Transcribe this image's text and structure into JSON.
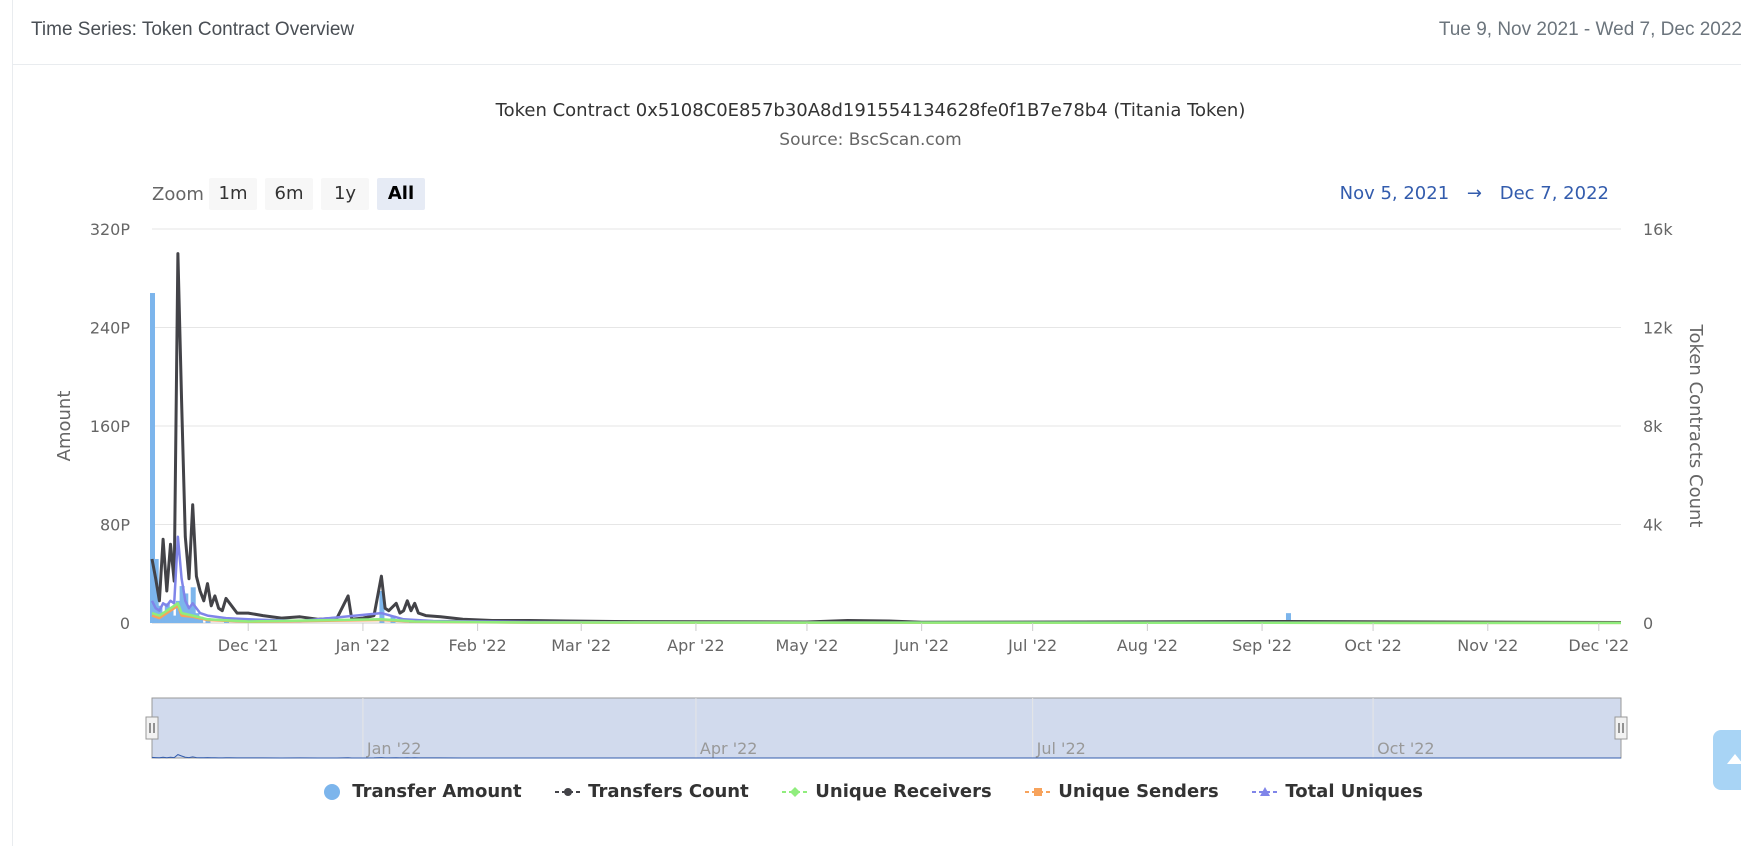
{
  "header": {
    "title": "Time Series: Token Contract Overview",
    "date_range": "Tue 9, Nov 2021 - Wed 7, Dec 2022"
  },
  "zoom": {
    "label": "Zoom",
    "buttons": [
      "1m",
      "6m",
      "1y",
      "All"
    ],
    "selected": "All"
  },
  "range_display": {
    "from": "Nov 5, 2021",
    "arrow": "→",
    "to": "Dec 7, 2022"
  },
  "scroll_top": {
    "icon": "arrow-up-icon"
  },
  "chart_data": {
    "type": "line",
    "title": "Token Contract 0x5108C0E857b30A8d191554134628fe0f1B7e78b4 (Titania Token)",
    "subtitle": "Source: BscScan.com",
    "x_range": [
      "2021-11-05",
      "2022-12-07"
    ],
    "x_ticks": [
      {
        "date": "2021-12-01",
        "label": "Dec '21"
      },
      {
        "date": "2022-01-01",
        "label": "Jan '22"
      },
      {
        "date": "2022-02-01",
        "label": "Feb '22"
      },
      {
        "date": "2022-03-01",
        "label": "Mar '22"
      },
      {
        "date": "2022-04-01",
        "label": "Apr '22"
      },
      {
        "date": "2022-05-01",
        "label": "May '22"
      },
      {
        "date": "2022-06-01",
        "label": "Jun '22"
      },
      {
        "date": "2022-07-01",
        "label": "Jul '22"
      },
      {
        "date": "2022-08-01",
        "label": "Aug '22"
      },
      {
        "date": "2022-09-01",
        "label": "Sep '22"
      },
      {
        "date": "2022-10-01",
        "label": "Oct '22"
      },
      {
        "date": "2022-11-01",
        "label": "Nov '22"
      },
      {
        "date": "2022-12-01",
        "label": "Dec '22"
      }
    ],
    "navigator_ticks": [
      {
        "date": "2022-01-01",
        "label": "Jan '22"
      },
      {
        "date": "2022-04-01",
        "label": "Apr '22"
      },
      {
        "date": "2022-07-01",
        "label": "Jul '22"
      },
      {
        "date": "2022-10-01",
        "label": "Oct '22"
      }
    ],
    "y_left": {
      "label": "Amount",
      "min": 0,
      "max": 320,
      "ticks": [
        0,
        80,
        160,
        240,
        320
      ],
      "tick_labels": [
        "0",
        "80P",
        "160P",
        "240P",
        "320P"
      ]
    },
    "y_right": {
      "label": "Token Contracts Count",
      "min": 0,
      "max": 16000,
      "ticks": [
        0,
        4000,
        8000,
        12000,
        16000
      ],
      "tick_labels": [
        "0",
        "4k",
        "8k",
        "12k",
        "16k"
      ]
    },
    "grid": true,
    "legend_position": "bottom",
    "series": [
      {
        "name": "Transfer Amount",
        "type": "column",
        "axis": "left",
        "color": "#7cb5ec",
        "points": [
          [
            "2021-11-05",
            268
          ],
          [
            "2021-11-06",
            52
          ],
          [
            "2021-11-07",
            14
          ],
          [
            "2021-11-08",
            9
          ],
          [
            "2021-11-09",
            16
          ],
          [
            "2021-11-10",
            11
          ],
          [
            "2021-11-11",
            6
          ],
          [
            "2021-11-12",
            18
          ],
          [
            "2021-11-13",
            30
          ],
          [
            "2021-11-14",
            24
          ],
          [
            "2021-11-15",
            12
          ],
          [
            "2021-11-16",
            29
          ],
          [
            "2021-11-17",
            8
          ],
          [
            "2021-11-18",
            5
          ],
          [
            "2021-11-20",
            4
          ],
          [
            "2021-11-25",
            3
          ],
          [
            "2021-12-02",
            2
          ],
          [
            "2022-01-06",
            26
          ],
          [
            "2022-01-09",
            6
          ],
          [
            "2022-01-14",
            3
          ],
          [
            "2022-09-08",
            8
          ]
        ]
      },
      {
        "name": "Transfers Count",
        "type": "line",
        "axis": "right",
        "color": "#434348",
        "points": [
          [
            "2021-11-05",
            2600
          ],
          [
            "2021-11-06",
            1800
          ],
          [
            "2021-11-07",
            900
          ],
          [
            "2021-11-08",
            3400
          ],
          [
            "2021-11-09",
            1300
          ],
          [
            "2021-11-10",
            3200
          ],
          [
            "2021-11-11",
            1700
          ],
          [
            "2021-11-12",
            15000
          ],
          [
            "2021-11-13",
            9000
          ],
          [
            "2021-11-14",
            3500
          ],
          [
            "2021-11-15",
            1800
          ],
          [
            "2021-11-16",
            4800
          ],
          [
            "2021-11-17",
            1900
          ],
          [
            "2021-11-18",
            1300
          ],
          [
            "2021-11-19",
            900
          ],
          [
            "2021-11-20",
            1600
          ],
          [
            "2021-11-21",
            700
          ],
          [
            "2021-11-22",
            1100
          ],
          [
            "2021-11-23",
            600
          ],
          [
            "2021-11-24",
            500
          ],
          [
            "2021-11-25",
            1000
          ],
          [
            "2021-11-26",
            800
          ],
          [
            "2021-11-28",
            400
          ],
          [
            "2021-12-01",
            400
          ],
          [
            "2021-12-05",
            300
          ],
          [
            "2021-12-10",
            200
          ],
          [
            "2021-12-15",
            250
          ],
          [
            "2021-12-20",
            150
          ],
          [
            "2021-12-25",
            200
          ],
          [
            "2021-12-28",
            1100
          ],
          [
            "2021-12-29",
            150
          ],
          [
            "2022-01-01",
            200
          ],
          [
            "2022-01-04",
            300
          ],
          [
            "2022-01-06",
            1900
          ],
          [
            "2022-01-07",
            600
          ],
          [
            "2022-01-08",
            500
          ],
          [
            "2022-01-10",
            800
          ],
          [
            "2022-01-11",
            400
          ],
          [
            "2022-01-12",
            500
          ],
          [
            "2022-01-13",
            900
          ],
          [
            "2022-01-14",
            500
          ],
          [
            "2022-01-15",
            800
          ],
          [
            "2022-01-16",
            400
          ],
          [
            "2022-01-18",
            300
          ],
          [
            "2022-01-22",
            250
          ],
          [
            "2022-01-28",
            150
          ],
          [
            "2022-02-05",
            100
          ],
          [
            "2022-02-15",
            100
          ],
          [
            "2022-02-25",
            80
          ],
          [
            "2022-03-10",
            60
          ],
          [
            "2022-04-01",
            50
          ],
          [
            "2022-05-01",
            40
          ],
          [
            "2022-05-12",
            100
          ],
          [
            "2022-05-23",
            80
          ],
          [
            "2022-06-01",
            30
          ],
          [
            "2022-09-08",
            60
          ],
          [
            "2022-12-07",
            20
          ]
        ]
      },
      {
        "name": "Unique Receivers",
        "type": "line",
        "axis": "right",
        "color": "#90ed7d",
        "points": [
          [
            "2021-11-05",
            400
          ],
          [
            "2021-11-07",
            300
          ],
          [
            "2021-11-09",
            500
          ],
          [
            "2021-11-12",
            800
          ],
          [
            "2021-11-13",
            400
          ],
          [
            "2021-11-16",
            300
          ],
          [
            "2021-11-20",
            150
          ],
          [
            "2021-12-01",
            60
          ],
          [
            "2022-01-06",
            150
          ],
          [
            "2022-01-15",
            60
          ],
          [
            "2022-02-15",
            20
          ],
          [
            "2022-12-07",
            5
          ]
        ]
      },
      {
        "name": "Unique Senders",
        "type": "line",
        "axis": "right",
        "color": "#f7a35c",
        "points": [
          [
            "2021-11-05",
            300
          ],
          [
            "2021-11-07",
            200
          ],
          [
            "2021-11-09",
            400
          ],
          [
            "2021-11-12",
            700
          ],
          [
            "2021-11-13",
            300
          ],
          [
            "2021-11-16",
            250
          ],
          [
            "2021-11-20",
            120
          ],
          [
            "2021-12-01",
            50
          ],
          [
            "2022-01-06",
            120
          ],
          [
            "2022-01-15",
            50
          ],
          [
            "2022-02-15",
            15
          ],
          [
            "2022-12-07",
            5
          ]
        ]
      },
      {
        "name": "Total Uniques",
        "type": "line",
        "axis": "right",
        "color": "#8085e9",
        "points": [
          [
            "2021-11-05",
            900
          ],
          [
            "2021-11-06",
            600
          ],
          [
            "2021-11-07",
            500
          ],
          [
            "2021-11-08",
            800
          ],
          [
            "2021-11-09",
            700
          ],
          [
            "2021-11-10",
            900
          ],
          [
            "2021-11-11",
            800
          ],
          [
            "2021-11-12",
            3500
          ],
          [
            "2021-11-13",
            1800
          ],
          [
            "2021-11-14",
            900
          ],
          [
            "2021-11-15",
            600
          ],
          [
            "2021-11-16",
            800
          ],
          [
            "2021-11-18",
            400
          ],
          [
            "2021-11-20",
            300
          ],
          [
            "2021-11-25",
            200
          ],
          [
            "2021-12-01",
            150
          ],
          [
            "2021-12-15",
            80
          ],
          [
            "2022-01-06",
            400
          ],
          [
            "2022-01-12",
            150
          ],
          [
            "2022-01-20",
            80
          ],
          [
            "2022-02-15",
            40
          ],
          [
            "2022-04-01",
            20
          ],
          [
            "2022-12-07",
            10
          ]
        ]
      }
    ]
  }
}
